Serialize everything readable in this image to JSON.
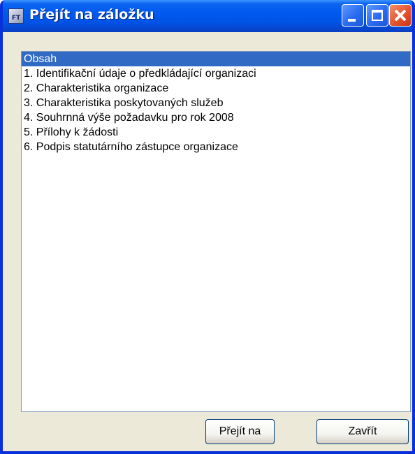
{
  "window": {
    "title": "Přejít na záložku",
    "app_icon": {
      "name": "ft-app-icon",
      "text": "FT"
    },
    "controls": {
      "minimize_icon": "minimize-icon",
      "maximize_icon": "maximize-icon",
      "close_icon": "close-icon"
    }
  },
  "bookmarks": {
    "selected_index": 0,
    "items": [
      {
        "label": "Obsah"
      },
      {
        "label": "1. Identifikační údaje o předkládající organizaci"
      },
      {
        "label": "2. Charakteristika organizace"
      },
      {
        "label": "3. Charakteristika poskytovaných služeb"
      },
      {
        "label": "4. Souhrnná výše požadavku pro rok 2008"
      },
      {
        "label": "5. Přílohy k žádosti"
      },
      {
        "label": "6. Podpis statutárního zástupce organizace"
      }
    ]
  },
  "buttons": {
    "go_label": "Přejít na",
    "close_label": "Zavřít"
  },
  "colors": {
    "titlebar": "#0058ee",
    "selection": "#316ac5",
    "close_button": "#e4542d",
    "dialog_background": "#ece9d8"
  }
}
